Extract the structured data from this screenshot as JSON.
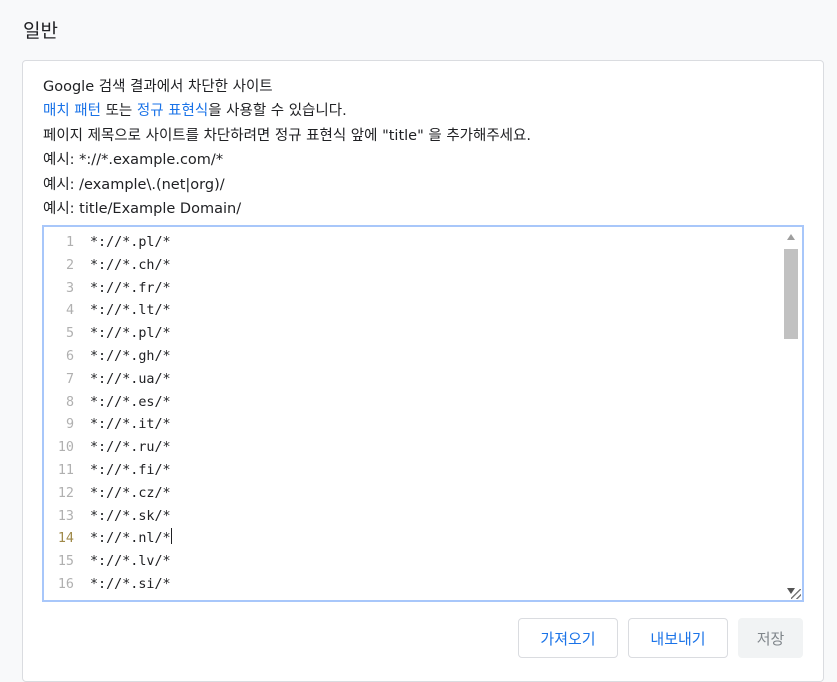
{
  "section": {
    "title": "일반"
  },
  "description": {
    "line1": "Google 검색 결과에서 차단한 사이트",
    "match_patterns_link": "매치 패턴",
    "or_text": " 또는 ",
    "regex_link": "정규 표현식",
    "usable_text": "을 사용할 수 있습니다.",
    "line3": "페이지 제목으로 사이트를 차단하려면 정규 표현식 앞에 \"title\" 을 추가해주세요.",
    "example1": "예시: *://*.example.com/*",
    "example2": "예시: /example\\.(net|org)/",
    "example3": "예시: title/Example Domain/"
  },
  "editor": {
    "active_line": 14,
    "lines": [
      {
        "n": "1",
        "text": "*://*.pl/*"
      },
      {
        "n": "2",
        "text": "*://*.ch/*"
      },
      {
        "n": "3",
        "text": "*://*.fr/*"
      },
      {
        "n": "4",
        "text": "*://*.lt/*"
      },
      {
        "n": "5",
        "text": "*://*.pl/*"
      },
      {
        "n": "6",
        "text": "*://*.gh/*"
      },
      {
        "n": "7",
        "text": "*://*.ua/*"
      },
      {
        "n": "8",
        "text": "*://*.es/*"
      },
      {
        "n": "9",
        "text": "*://*.it/*"
      },
      {
        "n": "10",
        "text": "*://*.ru/*"
      },
      {
        "n": "11",
        "text": "*://*.fi/*"
      },
      {
        "n": "12",
        "text": "*://*.cz/*"
      },
      {
        "n": "13",
        "text": "*://*.sk/*"
      },
      {
        "n": "14",
        "text": "*://*.nl/*"
      },
      {
        "n": "15",
        "text": "*://*.lv/*"
      },
      {
        "n": "16",
        "text": "*://*.si/*"
      }
    ]
  },
  "buttons": {
    "import_label": "가져오기",
    "export_label": "내보내기",
    "save_label": "저장"
  },
  "colors": {
    "link": "#1a73e8",
    "editor_focus_border": "#a8c7fa",
    "disabled_text": "#80868b"
  }
}
